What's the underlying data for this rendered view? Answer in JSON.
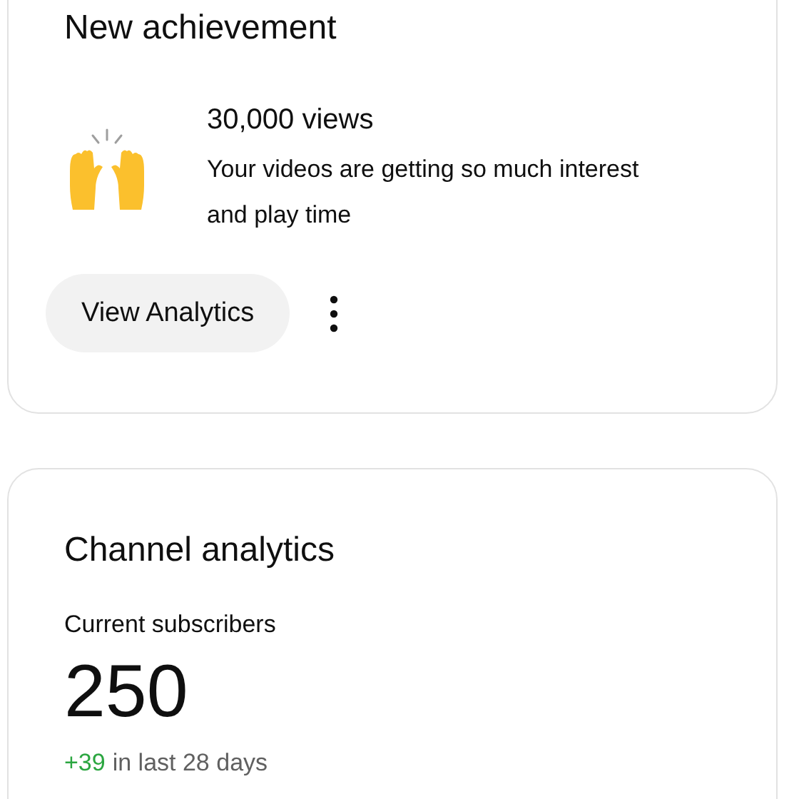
{
  "achievement_card": {
    "title": "New achievement",
    "headline": "30,000 views",
    "message": "Your videos are getting so much interest and play time",
    "button": "View Analytics"
  },
  "analytics_card": {
    "title": "Channel analytics",
    "metric_label": "Current subscribers",
    "metric_value": "250",
    "change": "+39",
    "change_period": "in last 28 days"
  }
}
